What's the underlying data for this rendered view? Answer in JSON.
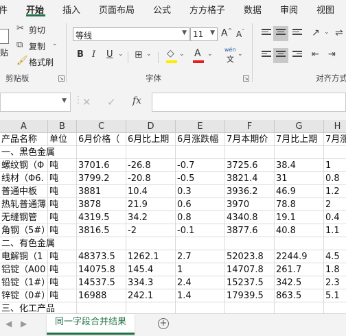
{
  "tabs": [
    {
      "label": "件",
      "active": false
    },
    {
      "label": "开始",
      "active": true
    },
    {
      "label": "插入",
      "active": false
    },
    {
      "label": "页面布局",
      "active": false
    },
    {
      "label": "公式",
      "active": false
    },
    {
      "label": "方方格子",
      "active": false
    },
    {
      "label": "数据",
      "active": false
    },
    {
      "label": "审阅",
      "active": false
    },
    {
      "label": "视图",
      "active": false
    }
  ],
  "ribbon": {
    "clipboard": {
      "paste_label": "贴",
      "cut_label": "剪切",
      "copy_label": "复制",
      "format_painter_label": "格式刷",
      "group_label": "剪贴板"
    },
    "font": {
      "font_name": "等线",
      "font_size": "11",
      "bold": "B",
      "italic": "I",
      "underline": "U",
      "grow": "A",
      "shrink": "A",
      "font_color_glyph": "A",
      "wen": "wén",
      "wen_char": "文",
      "group_label": "字体"
    },
    "alignment": {
      "group_label": "对齐方式"
    }
  },
  "formula_bar": {
    "cancel": "✕",
    "enter": "✓",
    "fx": "fx",
    "name_value": "",
    "formula_value": ""
  },
  "columns": [
    "A",
    "B",
    "C",
    "D",
    "E",
    "F",
    "G",
    "H"
  ],
  "rows": [
    [
      "产品名称",
      "单位",
      "6月价格（",
      "6月比上期",
      "6月涨跌幅",
      "7月本期价",
      "7月比上期",
      "7月涨"
    ],
    [
      "一、黑色金属",
      "",
      "",
      "",
      "",
      "",
      "",
      ""
    ],
    [
      "螺纹钢（Φ",
      "吨",
      "3701.6",
      "-26.8",
      "-0.7",
      "3725.6",
      "38.4",
      "1"
    ],
    [
      "线材（Φ6.",
      "吨",
      "3799.2",
      "-20.8",
      "-0.5",
      "3821.4",
      "31",
      "0.8"
    ],
    [
      "普通中板",
      "吨",
      "3881",
      "10.4",
      "0.3",
      "3936.2",
      "46.9",
      "1.2"
    ],
    [
      "热轧普通薄",
      "吨",
      "3878",
      "21.9",
      "0.6",
      "3970",
      "78.8",
      "2"
    ],
    [
      "无缝钢管",
      "吨",
      "4319.5",
      "34.2",
      "0.8",
      "4340.8",
      "19.1",
      "0.4"
    ],
    [
      "角钢（5#）",
      "吨",
      "3816.5",
      "-2",
      "-0.1",
      "3877.6",
      "40.8",
      "1.1"
    ],
    [
      "二、有色金属",
      "",
      "",
      "",
      "",
      "",
      "",
      ""
    ],
    [
      "电解铜（1",
      "吨",
      "48373.5",
      "1262.1",
      "2.7",
      "52023.8",
      "2244.9",
      "4.5"
    ],
    [
      "铝锭（A00",
      "吨",
      "14075.8",
      "145.4",
      "1",
      "14707.8",
      "261.7",
      "1.8"
    ],
    [
      "铅锭（1#）",
      "吨",
      "14537.5",
      "334.3",
      "2.4",
      "15237.5",
      "342.5",
      "2.3"
    ],
    [
      "锌锭（0#）",
      "吨",
      "16988",
      "242.1",
      "1.4",
      "17939.5",
      "863.5",
      "5.1"
    ],
    [
      "三、化工产品",
      "",
      "",
      "",
      "",
      "",
      "",
      ""
    ]
  ],
  "sheet_tabs": {
    "active_label": "同一字段合并结果",
    "add_symbol": "+"
  },
  "colors": {
    "accent": "#217346",
    "font_color": "#e02020",
    "highlight": "#ffeb00"
  }
}
